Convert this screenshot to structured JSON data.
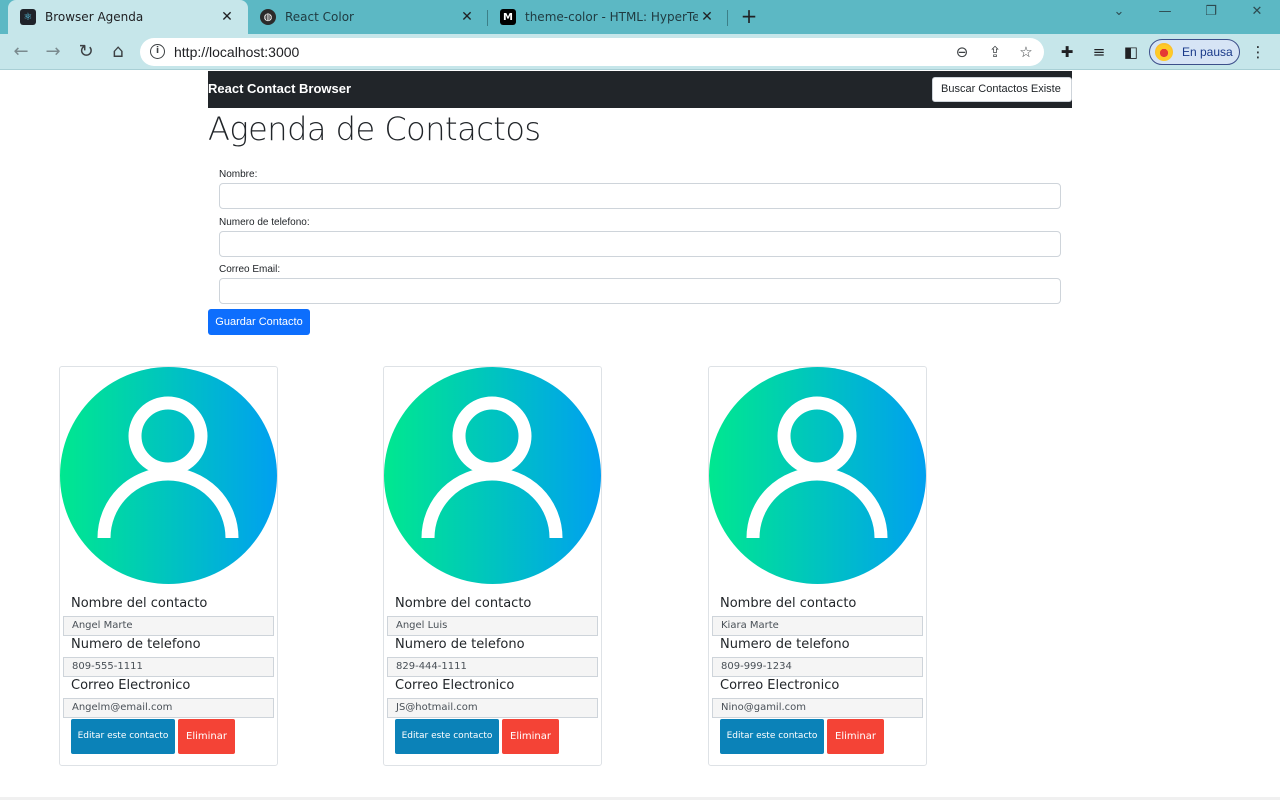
{
  "browser": {
    "tabs": [
      {
        "title": "Browser Agenda",
        "active": true
      },
      {
        "title": "React Color",
        "active": false
      },
      {
        "title": "theme-color - HTML: HyperText M",
        "active": false
      }
    ],
    "url": "http://localhost:3000",
    "profile_label": "En pausa"
  },
  "page": {
    "brand": "React Contact Browser",
    "search_placeholder": "Buscar Contactos Existe",
    "heading": "Agenda de Contactos",
    "form": {
      "name_label": "Nombre:",
      "phone_label": "Numero de telefono:",
      "email_label": "Correo Email:",
      "name_value": "",
      "phone_value": "",
      "email_value": "",
      "submit_label": "Guardar Contacto"
    },
    "card_labels": {
      "name": "Nombre del contacto",
      "phone": "Numero de telefono",
      "email": "Correo Electronico",
      "edit": "Editar este contacto",
      "delete": "Eliminar"
    },
    "contacts": [
      {
        "name": "Angel Marte",
        "phone": "809-555-1111",
        "email": "Angelm@email.com"
      },
      {
        "name": "Angel Luis",
        "phone": "829-444-1111",
        "email": "JS@hotmail.com"
      },
      {
        "name": "Kiara Marte",
        "phone": "809-999-1234",
        "email": "Nino@gamil.com"
      }
    ]
  },
  "colors": {
    "navbar": "#212529",
    "primary": "#0d6efd",
    "edit": "#0b82b8",
    "delete": "#f44336",
    "avatar_gradient_start": "#00e88f",
    "avatar_gradient_end": "#00a0f0"
  }
}
